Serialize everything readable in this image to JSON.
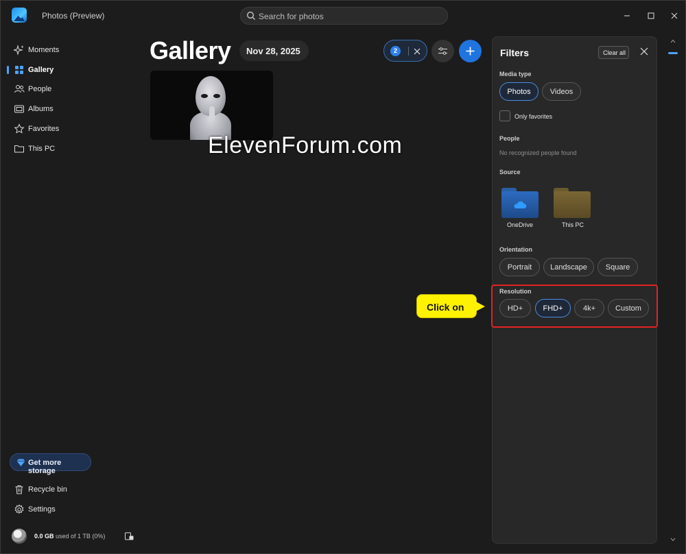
{
  "app": {
    "title": "Photos (Preview)"
  },
  "search": {
    "placeholder": "Search for photos"
  },
  "sidebar": {
    "items": [
      {
        "label": "Moments",
        "icon": "sparkle-icon"
      },
      {
        "label": "Gallery",
        "icon": "gallery-icon",
        "active": true
      },
      {
        "label": "People",
        "icon": "people-icon"
      },
      {
        "label": "Albums",
        "icon": "albums-icon"
      },
      {
        "label": "Favorites",
        "icon": "star-icon"
      },
      {
        "label": "This PC",
        "icon": "folder-icon"
      }
    ],
    "storage_button": "Get more storage",
    "bottom_items": [
      {
        "label": "Recycle bin",
        "icon": "trash-icon"
      },
      {
        "label": "Settings",
        "icon": "gear-icon"
      }
    ],
    "account": {
      "used": "0.0 GB",
      "rest": "used of 1 TB (0%)"
    }
  },
  "main": {
    "title": "Gallery",
    "date": "Nov 28, 2025",
    "filter_count": "2"
  },
  "filters": {
    "title": "Filters",
    "clear_all": "Clear all",
    "media_type_label": "Media type",
    "media_types": [
      "Photos",
      "Videos"
    ],
    "only_favorites": "Only favorites",
    "people_label": "People",
    "people_empty": "No recognized people found",
    "source_label": "Source",
    "sources": [
      "OneDrive",
      "This PC"
    ],
    "orientation_label": "Orientation",
    "orientations": [
      "Portrait",
      "Landscape",
      "Square"
    ],
    "resolution_label": "Resolution",
    "resolutions": [
      "HD+",
      "FHD+",
      "4k+",
      "Custom"
    ]
  },
  "overlay": {
    "watermark": "ElevenForum.com",
    "callout": "Click on"
  },
  "colors": {
    "accent": "#1f74e0",
    "callout": "#fff200",
    "highlight": "#e52222"
  }
}
